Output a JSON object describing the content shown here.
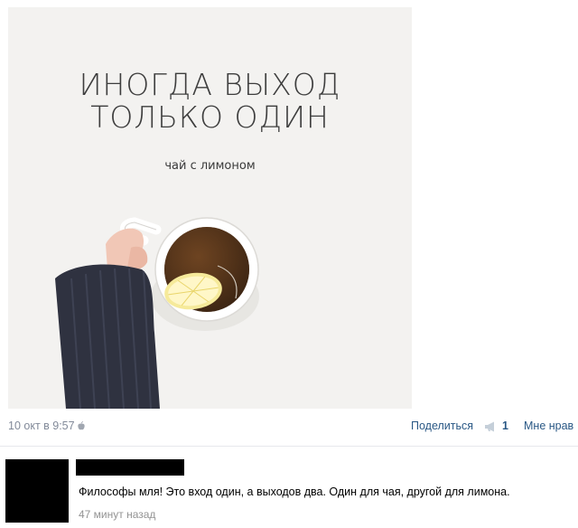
{
  "post": {
    "image": {
      "title_line1": "ИНОГДА ВЫХОД",
      "title_line2": "ТОЛЬКО ОДИН",
      "subtitle": "чай с лимоном"
    },
    "date": "10 окт в 9:57",
    "share_label": "Поделиться",
    "share_count": "1",
    "like_label": "Мне нрав"
  },
  "comment": {
    "text": "Философы мля! Это вход один, а выходов два. Один для чая, другой для лимона.",
    "time": "47 минут назад"
  },
  "icons": {
    "apple": "apple-icon",
    "megaphone": "megaphone-icon"
  },
  "colors": {
    "link": "#2a5885",
    "meta_text": "#828a99",
    "image_background": "#f3f2f0"
  }
}
